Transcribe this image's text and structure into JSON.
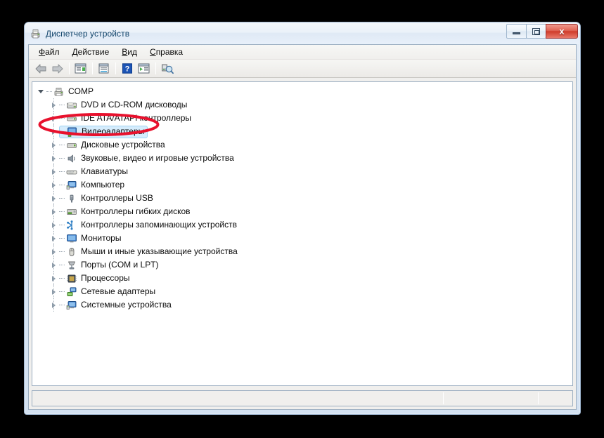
{
  "window": {
    "title": "Диспетчер устройств",
    "icon": "device-manager-icon",
    "controls": {
      "minimize": "—",
      "maximize": "□",
      "close": "x"
    }
  },
  "menubar": {
    "items": [
      {
        "name": "file",
        "accel": "Ф",
        "rest": "айл"
      },
      {
        "name": "action",
        "accel": "Д",
        "rest": "ействие"
      },
      {
        "name": "view",
        "accel": "В",
        "rest": "ид"
      },
      {
        "name": "help",
        "accel": "С",
        "rest": "правка"
      }
    ]
  },
  "toolbar": {
    "buttons": [
      {
        "name": "back-button",
        "icon": "arrow-left-icon"
      },
      {
        "name": "forward-button",
        "icon": "arrow-right-icon"
      },
      {
        "name": "show-hide-tree-button",
        "icon": "console-tree-icon"
      },
      {
        "name": "properties-button",
        "icon": "properties-icon"
      },
      {
        "name": "help-button",
        "icon": "help-question-icon"
      },
      {
        "name": "update-driver-button",
        "icon": "update-driver-icon"
      },
      {
        "name": "scan-hardware-button",
        "icon": "scan-hardware-icon"
      }
    ]
  },
  "tree": {
    "root": {
      "label": "COMP",
      "icon": "computer-root-icon",
      "expanded": true
    },
    "items": [
      {
        "label": "DVD и CD-ROM дисководы",
        "icon": "dvd-drive-icon",
        "selected": false
      },
      {
        "label": "IDE ATA/ATAPI контроллеры",
        "icon": "ide-controller-icon",
        "selected": false
      },
      {
        "label": "Видеоадаптеры",
        "icon": "display-adapter-icon",
        "selected": true
      },
      {
        "label": "Дисковые устройства",
        "icon": "disk-drive-icon",
        "selected": false
      },
      {
        "label": "Звуковые, видео и игровые устройства",
        "icon": "sound-device-icon",
        "selected": false
      },
      {
        "label": "Клавиатуры",
        "icon": "keyboard-icon",
        "selected": false
      },
      {
        "label": "Компьютер",
        "icon": "computer-icon",
        "selected": false
      },
      {
        "label": "Контроллеры USB",
        "icon": "usb-controller-icon",
        "selected": false
      },
      {
        "label": "Контроллеры гибких дисков",
        "icon": "floppy-controller-icon",
        "selected": false
      },
      {
        "label": "Контроллеры запоминающих устройств",
        "icon": "storage-controller-icon",
        "selected": false
      },
      {
        "label": "Мониторы",
        "icon": "monitor-icon",
        "selected": false
      },
      {
        "label": "Мыши и иные указывающие устройства",
        "icon": "mouse-icon",
        "selected": false
      },
      {
        "label": "Порты (COM и LPT)",
        "icon": "port-icon",
        "selected": false
      },
      {
        "label": "Процессоры",
        "icon": "processor-icon",
        "selected": false
      },
      {
        "label": "Сетевые адаптеры",
        "icon": "network-adapter-icon",
        "selected": false
      },
      {
        "label": "Системные устройства",
        "icon": "system-device-icon",
        "selected": false
      }
    ]
  },
  "statusbar": {
    "text": "",
    "pane2": "",
    "pane3": ""
  },
  "annotation": {
    "shape": "ellipse",
    "target": "Видеоадаптеры",
    "color": "#e8112d"
  },
  "colors": {
    "accent": "#e8112d",
    "selection": "#d5ecfc",
    "title_text": "#12456b",
    "window_bg": "#dbe7f4"
  }
}
